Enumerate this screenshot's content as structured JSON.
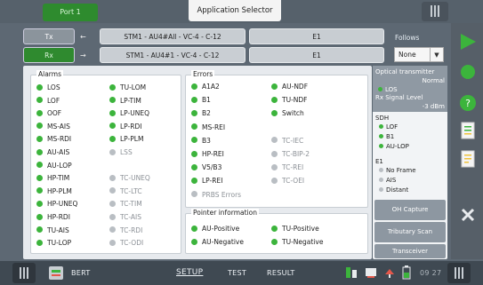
{
  "header": {
    "port_tab": "Port 1",
    "app_selector": "Application Selector"
  },
  "rows": {
    "tx": {
      "label": "Tx",
      "path": "STM1 - AU4#All - VC-4 - C-12",
      "e1": "E1"
    },
    "rx": {
      "label": "Rx",
      "path": "STM1 - AU4#1 - VC-4 - C-12",
      "e1": "E1"
    }
  },
  "follows": {
    "label": "Follows",
    "value": "None"
  },
  "alarms": {
    "title": "Alarms",
    "col1": [
      {
        "label": "LOS",
        "active": true
      },
      {
        "label": "LOF",
        "active": true
      },
      {
        "label": "OOF",
        "active": true
      },
      {
        "label": "MS-AIS",
        "active": true
      },
      {
        "label": "MS-RDI",
        "active": true
      },
      {
        "label": "AU-AIS",
        "active": true
      },
      {
        "label": "AU-LOP",
        "active": true
      },
      {
        "label": "HP-TIM",
        "active": true
      },
      {
        "label": "HP-PLM",
        "active": true
      },
      {
        "label": "HP-UNEQ",
        "active": true
      },
      {
        "label": "HP-RDI",
        "active": true
      },
      {
        "label": "TU-AIS",
        "active": true
      },
      {
        "label": "TU-LOP",
        "active": true
      }
    ],
    "col2": [
      {
        "label": "TU-LOM",
        "active": true
      },
      {
        "label": "LP-TIM",
        "active": true
      },
      {
        "label": "LP-UNEQ",
        "active": true
      },
      {
        "label": "LP-RDI",
        "active": true
      },
      {
        "label": "LP-PLM",
        "active": true
      },
      {
        "label": "LSS",
        "active": false
      },
      {
        "label": "",
        "active": false
      },
      {
        "label": "TC-UNEQ",
        "active": false
      },
      {
        "label": "TC-LTC",
        "active": false
      },
      {
        "label": "TC-TIM",
        "active": false
      },
      {
        "label": "TC-AIS",
        "active": false
      },
      {
        "label": "TC-RDI",
        "active": false
      },
      {
        "label": "TC-ODI",
        "active": false
      }
    ]
  },
  "errors": {
    "title": "Errors",
    "col1": [
      {
        "label": "A1A2",
        "active": true
      },
      {
        "label": "B1",
        "active": true
      },
      {
        "label": "B2",
        "active": true
      },
      {
        "label": "MS-REI",
        "active": true
      },
      {
        "label": "B3",
        "active": true
      },
      {
        "label": "HP-REI",
        "active": true
      },
      {
        "label": "V5/B3",
        "active": true
      },
      {
        "label": "LP-REI",
        "active": true
      },
      {
        "label": "PRBS Errors",
        "active": false
      }
    ],
    "col2": [
      {
        "label": "AU-NDF",
        "active": true
      },
      {
        "label": "TU-NDF",
        "active": true
      },
      {
        "label": "Switch",
        "active": true
      },
      {
        "label": "",
        "active": false
      },
      {
        "label": "TC-IEC",
        "active": false
      },
      {
        "label": "TC-BIP-2",
        "active": false
      },
      {
        "label": "TC-REI",
        "active": false
      },
      {
        "label": "TC-OEI",
        "active": false
      }
    ]
  },
  "pointer": {
    "title": "Pointer information",
    "col1": [
      {
        "label": "AU-Positive",
        "active": true
      },
      {
        "label": "AU-Negative",
        "active": true
      }
    ],
    "col2": [
      {
        "label": "TU-Positive",
        "active": true
      },
      {
        "label": "TU-Negative",
        "active": true
      }
    ]
  },
  "right_panel": {
    "optical_title": "Optical transmitter",
    "optical_status": "Normal",
    "los": "LOS",
    "signal_label": "Rx Signal Level",
    "signal_value": "-3 dBm",
    "sdh_title": "SDH",
    "sdh_items": [
      "LOF",
      "B1",
      "AU-LOP"
    ],
    "e1_title": "E1",
    "e1_items": [
      "No Frame",
      "AIS",
      "Distant"
    ],
    "buttons": [
      "OH Capture",
      "Tributary Scan",
      "Transceiver"
    ]
  },
  "footer": {
    "bert": "BERT",
    "setup": "SETUP",
    "test": "TEST",
    "result": "RESULT",
    "time": "09 27"
  },
  "colors": {
    "green": "#3cb43c",
    "inactive": "#b9bec3",
    "accent_green": "#2e8b2e"
  }
}
